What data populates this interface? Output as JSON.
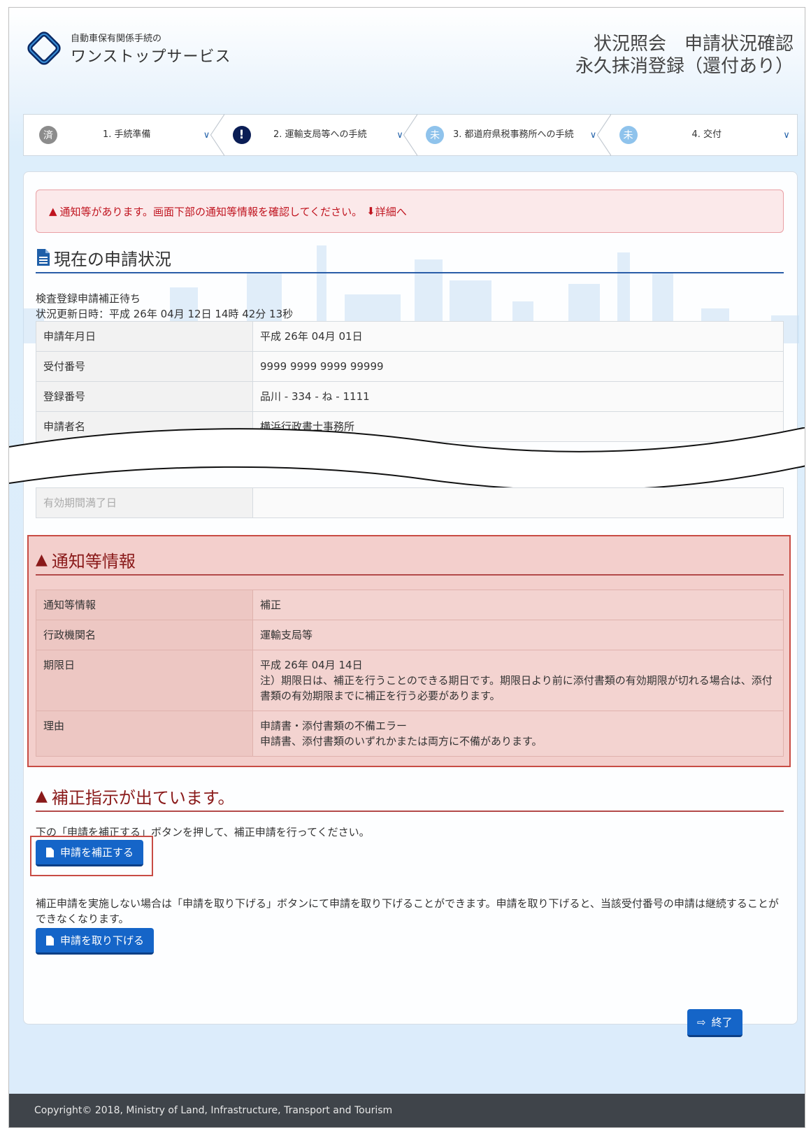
{
  "header": {
    "logo_small": "自動車保有関係手続の",
    "logo_big": "ワンストップサービス",
    "title_line1": "状況照会　申請状況確認",
    "title_line2": "永久抹消登録（還付あり）"
  },
  "steps": [
    {
      "badge": "済",
      "label": "1. 手続準備",
      "state": "done"
    },
    {
      "badge": "!",
      "label": "2. 運輸支局等への手続",
      "state": "warn"
    },
    {
      "badge": "未",
      "label": "3. 都道府県税事務所への手続",
      "state": "todo"
    },
    {
      "badge": "未",
      "label": "4. 交付",
      "state": "todo"
    }
  ],
  "alert": {
    "text": "通知等があります。画面下部の通知等情報を確認してください。",
    "link": "詳細へ"
  },
  "current": {
    "title": "現在の申請状況",
    "status": "検査登録申請補正待ち",
    "updated": "状況更新日時：平成 26年 04月 12日 14時 42分 13秒",
    "rows": [
      {
        "k": "申請年月日",
        "v": "平成 26年 04月 01日"
      },
      {
        "k": "受付番号",
        "v": "9999 9999 9999 99999"
      },
      {
        "k": "登録番号",
        "v": "品川 - 334 - ね - 1111"
      },
      {
        "k": "申請者名",
        "v": "横浜行政書士事務所"
      }
    ],
    "faded_rows": [
      {
        "k": "有効期間満了日",
        "v": ""
      }
    ]
  },
  "notice": {
    "title": "通知等情報",
    "rows": [
      {
        "k": "通知等情報",
        "v1": "補正",
        "v2": ""
      },
      {
        "k": "行政機関名",
        "v1": "運輸支局等",
        "v2": ""
      },
      {
        "k": "期限日",
        "v1": "平成 26年 04月 14日",
        "v2": "注）期限日は、補正を行うことのできる期日です。期限日より前に添付書類の有効期限が切れる場合は、添付書類の有効期限までに補正を行う必要があります。"
      },
      {
        "k": "理由",
        "v1": "申請書・添付書類の不備エラー",
        "v2": "申請書、添付書類のいずれかまたは両方に不備があります。"
      }
    ]
  },
  "correction": {
    "title": "補正指示が出ています。",
    "instruction": "下の「申請を補正する」ボタンを押して、補正申請を行ってください。",
    "correct_button": "申請を補正する",
    "withdraw_note": "補正申請を実施しない場合は「申請を取り下げる」ボタンにて申請を取り下げることができます。申請を取り下げると、当該受付番号の申請は継続することができなくなります。",
    "withdraw_button": "申請を取り下げる"
  },
  "exit_button": "終了",
  "footer": "Copyright© 2018, Ministry of Land, Infrastructure, Transport and Tourism"
}
